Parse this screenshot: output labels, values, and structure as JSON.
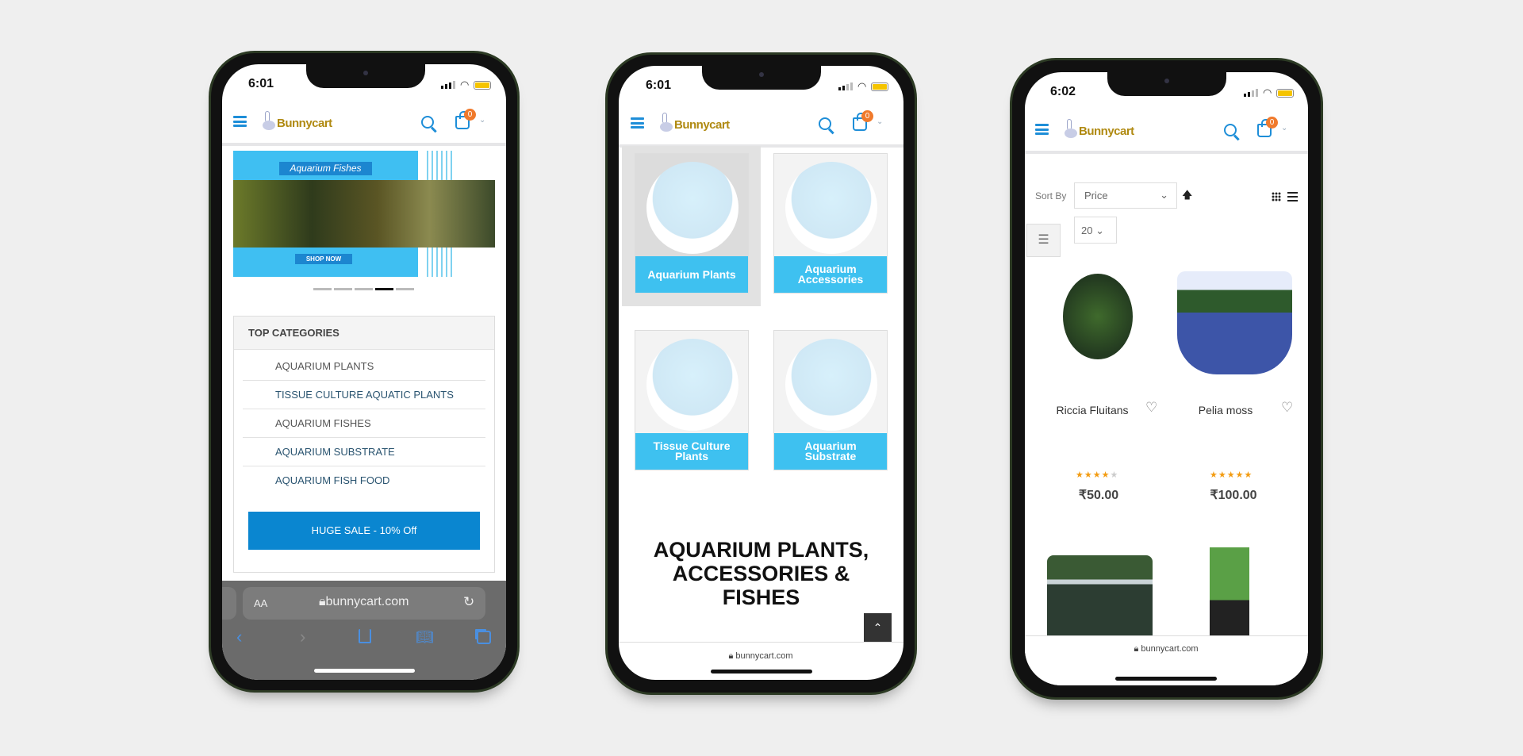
{
  "brand": {
    "name": "Bunnycart",
    "accent": "#1e8ed8",
    "badge_color": "#f07a2c",
    "cart_count": "0"
  },
  "phone1": {
    "time": "6:01",
    "banner": {
      "title": "Aquarium Fishes",
      "cta": "SHOP NOW",
      "slides": 5,
      "active_slide": 4
    },
    "categories": {
      "title": "TOP CATEGORIES",
      "items": [
        "AQUARIUM PLANTS",
        "TISSUE CULTURE AQUATIC PLANTS",
        "AQUARIUM FISHES",
        "AQUARIUM SUBSTRATE",
        "AQUARIUM FISH FOOD"
      ]
    },
    "sale_button": "HUGE SALE - 10% Off",
    "safari": {
      "aa": "AA",
      "url": "bunnycart.com"
    }
  },
  "phone2": {
    "time": "6:01",
    "tiles": [
      "Aquarium Plants",
      "Aquarium Accessories",
      "Tissue Culture Plants",
      "Aquarium Substrate"
    ],
    "heading_lines": [
      "AQUARIUM PLANTS,",
      "ACCESSORIES &",
      "FISHES"
    ],
    "url": "bunnycart.com"
  },
  "phone3": {
    "time": "6:02",
    "sort_label": "Sort By",
    "sort_value": "Price",
    "limit_value": "20",
    "products": [
      {
        "name": "Riccia Fluitans",
        "rating": 4,
        "price": "₹50.00"
      },
      {
        "name": "Pelia moss",
        "rating": 5,
        "price": "₹100.00"
      }
    ],
    "url": "bunnycart.com"
  }
}
